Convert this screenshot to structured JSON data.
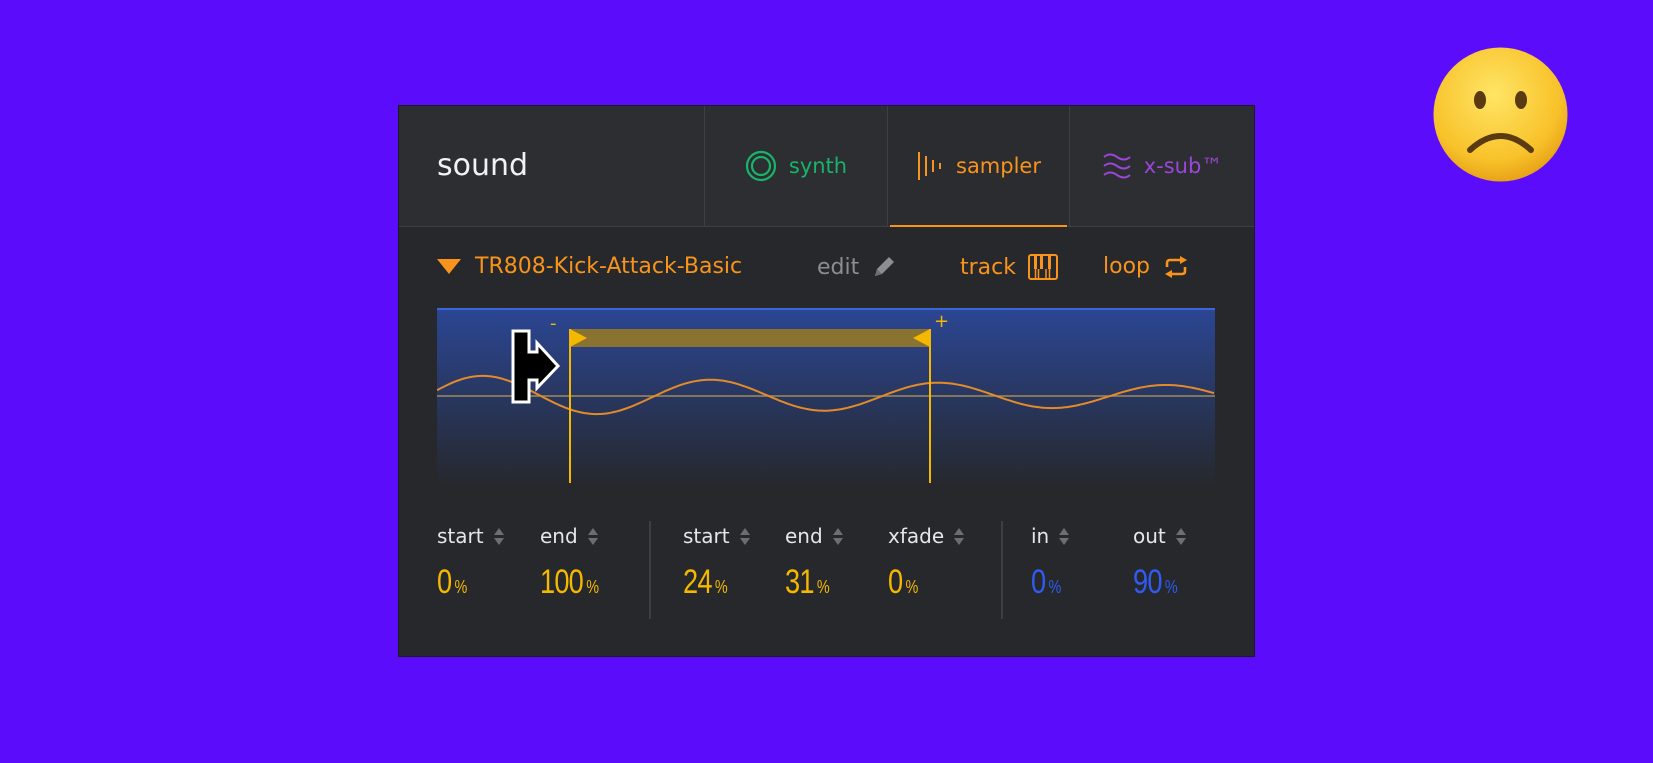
{
  "panel": {
    "title": "sound"
  },
  "tabs": [
    {
      "label": "synth",
      "icon": "ring-icon",
      "color": "#19b46a"
    },
    {
      "label": "sampler",
      "icon": "bars-icon",
      "color": "#f8941c",
      "active": true
    },
    {
      "label": "x-sub™",
      "icon": "waves-icon",
      "color": "#9b46d8"
    }
  ],
  "toolbar": {
    "sample_name": "TR808-Kick-Attack-Basic",
    "edit": "edit",
    "track": "track",
    "loop": "loop"
  },
  "waveform": {
    "minus_label": "-",
    "plus_label": "+",
    "loop_start_percent": 24,
    "loop_end_percent": 31,
    "colors": {
      "wave": "#e38a2a",
      "marker": "#f5b800",
      "bg_top": "#2b4694",
      "bg_bottom": "#26282c"
    }
  },
  "controls": {
    "sample_start": {
      "label": "start",
      "value": "0",
      "unit": "%"
    },
    "sample_end": {
      "label": "end",
      "value": "100",
      "unit": "%"
    },
    "loop_start": {
      "label": "start",
      "value": "24",
      "unit": "%"
    },
    "loop_end": {
      "label": "end",
      "value": "31",
      "unit": "%"
    },
    "xfade": {
      "label": "xfade",
      "value": "0",
      "unit": "%"
    },
    "fade_in": {
      "label": "in",
      "value": "0",
      "unit": "%"
    },
    "fade_out": {
      "label": "out",
      "value": "90",
      "unit": "%"
    }
  },
  "decor": {
    "emoji": "frowning-face-icon",
    "background": "#5b0dfb"
  }
}
